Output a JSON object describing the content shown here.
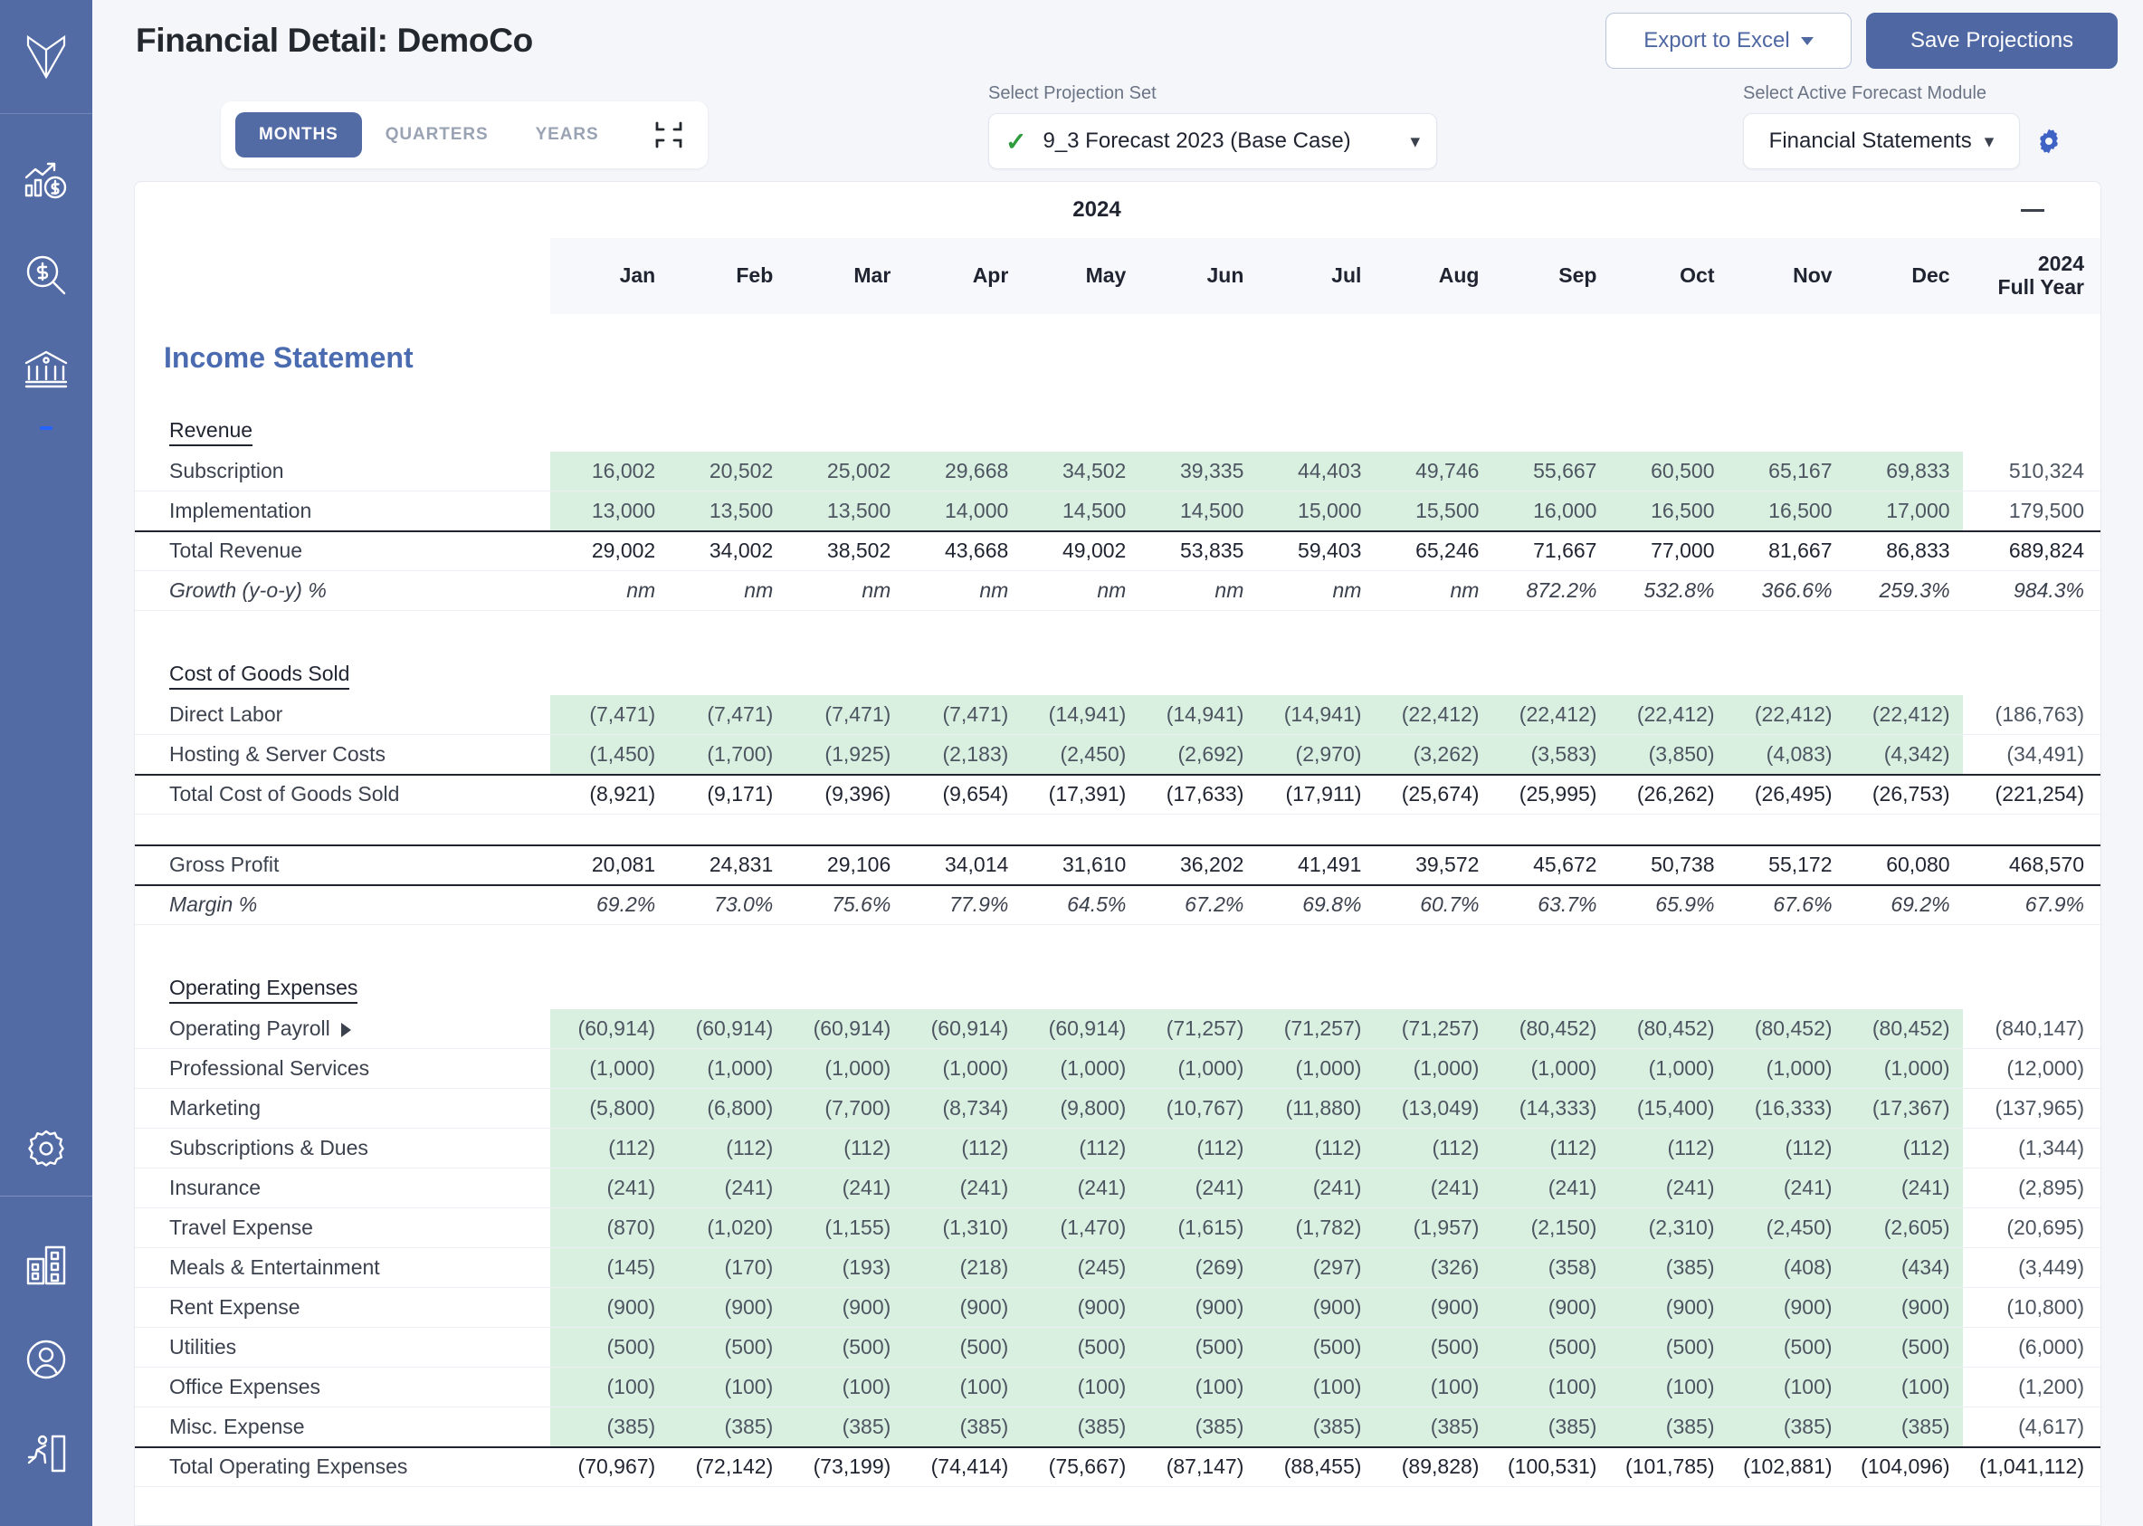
{
  "sidebar": {
    "logo_icon": "brand-chevron-logo",
    "items": [
      {
        "icon": "chart-growth-dollar-icon",
        "name": "analytics"
      },
      {
        "icon": "magnifier-dollar-icon",
        "name": "valuation"
      },
      {
        "icon": "bank-building-icon",
        "name": "banking"
      },
      {
        "icon": "gear-icon",
        "name": "settings"
      },
      {
        "icon": "company-buildings-icon",
        "name": "companies"
      },
      {
        "icon": "user-avatar-icon",
        "name": "account"
      },
      {
        "icon": "exit-door-icon",
        "name": "logout"
      }
    ]
  },
  "header": {
    "title": "Financial Detail: DemoCo",
    "export_label": "Export to Excel",
    "save_label": "Save Projections",
    "period_tabs": [
      {
        "label": "MONTHS",
        "active": true
      },
      {
        "label": "QUARTERS",
        "active": false
      },
      {
        "label": "YEARS",
        "active": false
      }
    ],
    "collapse_icon": "collapse-arrows-icon",
    "projection": {
      "label": "Select Projection Set",
      "value": "9_3 Forecast 2023 (Base Case)",
      "check_icon": "check-icon",
      "chevron_icon": "chevron-down-icon"
    },
    "module": {
      "label": "Select Active Forecast Module",
      "value": "Financial Statements",
      "chevron_icon": "chevron-down-icon",
      "gear_icon": "gear-icon"
    }
  },
  "table": {
    "year": "2024",
    "minimize_icon": "minimize-icon",
    "columns": [
      "Jan",
      "Feb",
      "Mar",
      "Apr",
      "May",
      "Jun",
      "Jul",
      "Aug",
      "Sep",
      "Oct",
      "Nov",
      "Dec"
    ],
    "fy_col_line1": "2024",
    "fy_col_line2": "Full Year",
    "statement_title": "Income Statement",
    "sections": [
      {
        "group": "Revenue",
        "rows": [
          {
            "label": "Subscription",
            "type": "input",
            "values": [
              "16,002",
              "20,502",
              "25,002",
              "29,668",
              "34,502",
              "39,335",
              "44,403",
              "49,746",
              "55,667",
              "60,500",
              "65,167",
              "69,833"
            ],
            "fy": "510,324"
          },
          {
            "label": "Implementation",
            "type": "input",
            "values": [
              "13,000",
              "13,500",
              "13,500",
              "14,000",
              "14,500",
              "14,500",
              "15,000",
              "15,500",
              "16,000",
              "16,500",
              "16,500",
              "17,000"
            ],
            "fy": "179,500"
          },
          {
            "label": "Total Revenue",
            "type": "total",
            "values": [
              "29,002",
              "34,002",
              "38,502",
              "43,668",
              "49,002",
              "53,835",
              "59,403",
              "65,246",
              "71,667",
              "77,000",
              "81,667",
              "86,833"
            ],
            "fy": "689,824"
          },
          {
            "label": "Growth (y-o-y) %",
            "type": "pct",
            "values": [
              "nm",
              "nm",
              "nm",
              "nm",
              "nm",
              "nm",
              "nm",
              "nm",
              "872.2%",
              "532.8%",
              "366.6%",
              "259.3%"
            ],
            "fy": "984.3%"
          }
        ]
      },
      {
        "group": "Cost of Goods Sold",
        "rows": [
          {
            "label": "Direct Labor",
            "type": "input",
            "values": [
              "(7,471)",
              "(7,471)",
              "(7,471)",
              "(7,471)",
              "(14,941)",
              "(14,941)",
              "(14,941)",
              "(22,412)",
              "(22,412)",
              "(22,412)",
              "(22,412)",
              "(22,412)"
            ],
            "fy": "(186,763)"
          },
          {
            "label": "Hosting & Server Costs",
            "type": "input",
            "values": [
              "(1,450)",
              "(1,700)",
              "(1,925)",
              "(2,183)",
              "(2,450)",
              "(2,692)",
              "(2,970)",
              "(3,262)",
              "(3,583)",
              "(3,850)",
              "(4,083)",
              "(4,342)"
            ],
            "fy": "(34,491)"
          },
          {
            "label": "Total Cost of Goods Sold",
            "type": "total",
            "values": [
              "(8,921)",
              "(9,171)",
              "(9,396)",
              "(9,654)",
              "(17,391)",
              "(17,633)",
              "(17,911)",
              "(25,674)",
              "(25,995)",
              "(26,262)",
              "(26,495)",
              "(26,753)"
            ],
            "fy": "(221,254)"
          }
        ]
      },
      {
        "group": "",
        "rows": [
          {
            "label": "Gross Profit",
            "type": "total-bb",
            "values": [
              "20,081",
              "24,831",
              "29,106",
              "34,014",
              "31,610",
              "36,202",
              "41,491",
              "39,572",
              "45,672",
              "50,738",
              "55,172",
              "60,080"
            ],
            "fy": "468,570"
          },
          {
            "label": "Margin %",
            "type": "pct",
            "values": [
              "69.2%",
              "73.0%",
              "75.6%",
              "77.9%",
              "64.5%",
              "67.2%",
              "69.8%",
              "60.7%",
              "63.7%",
              "65.9%",
              "67.6%",
              "69.2%"
            ],
            "fy": "67.9%"
          }
        ]
      },
      {
        "group": "Operating Expenses",
        "rows": [
          {
            "label": "Operating Payroll",
            "type": "input",
            "expandable": true,
            "values": [
              "(60,914)",
              "(60,914)",
              "(60,914)",
              "(60,914)",
              "(60,914)",
              "(71,257)",
              "(71,257)",
              "(71,257)",
              "(80,452)",
              "(80,452)",
              "(80,452)",
              "(80,452)"
            ],
            "fy": "(840,147)"
          },
          {
            "label": "Professional Services",
            "type": "input",
            "values": [
              "(1,000)",
              "(1,000)",
              "(1,000)",
              "(1,000)",
              "(1,000)",
              "(1,000)",
              "(1,000)",
              "(1,000)",
              "(1,000)",
              "(1,000)",
              "(1,000)",
              "(1,000)"
            ],
            "fy": "(12,000)"
          },
          {
            "label": "Marketing",
            "type": "input",
            "values": [
              "(5,800)",
              "(6,800)",
              "(7,700)",
              "(8,734)",
              "(9,800)",
              "(10,767)",
              "(11,880)",
              "(13,049)",
              "(14,333)",
              "(15,400)",
              "(16,333)",
              "(17,367)"
            ],
            "fy": "(137,965)"
          },
          {
            "label": "Subscriptions & Dues",
            "type": "input",
            "values": [
              "(112)",
              "(112)",
              "(112)",
              "(112)",
              "(112)",
              "(112)",
              "(112)",
              "(112)",
              "(112)",
              "(112)",
              "(112)",
              "(112)"
            ],
            "fy": "(1,344)"
          },
          {
            "label": "Insurance",
            "type": "input",
            "values": [
              "(241)",
              "(241)",
              "(241)",
              "(241)",
              "(241)",
              "(241)",
              "(241)",
              "(241)",
              "(241)",
              "(241)",
              "(241)",
              "(241)"
            ],
            "fy": "(2,895)"
          },
          {
            "label": "Travel Expense",
            "type": "input",
            "values": [
              "(870)",
              "(1,020)",
              "(1,155)",
              "(1,310)",
              "(1,470)",
              "(1,615)",
              "(1,782)",
              "(1,957)",
              "(2,150)",
              "(2,310)",
              "(2,450)",
              "(2,605)"
            ],
            "fy": "(20,695)"
          },
          {
            "label": "Meals & Entertainment",
            "type": "input",
            "values": [
              "(145)",
              "(170)",
              "(193)",
              "(218)",
              "(245)",
              "(269)",
              "(297)",
              "(326)",
              "(358)",
              "(385)",
              "(408)",
              "(434)"
            ],
            "fy": "(3,449)"
          },
          {
            "label": "Rent Expense",
            "type": "input",
            "values": [
              "(900)",
              "(900)",
              "(900)",
              "(900)",
              "(900)",
              "(900)",
              "(900)",
              "(900)",
              "(900)",
              "(900)",
              "(900)",
              "(900)"
            ],
            "fy": "(10,800)"
          },
          {
            "label": "Utilities",
            "type": "input",
            "values": [
              "(500)",
              "(500)",
              "(500)",
              "(500)",
              "(500)",
              "(500)",
              "(500)",
              "(500)",
              "(500)",
              "(500)",
              "(500)",
              "(500)"
            ],
            "fy": "(6,000)"
          },
          {
            "label": "Office Expenses",
            "type": "input",
            "values": [
              "(100)",
              "(100)",
              "(100)",
              "(100)",
              "(100)",
              "(100)",
              "(100)",
              "(100)",
              "(100)",
              "(100)",
              "(100)",
              "(100)"
            ],
            "fy": "(1,200)"
          },
          {
            "label": "Misc. Expense",
            "type": "input",
            "values": [
              "(385)",
              "(385)",
              "(385)",
              "(385)",
              "(385)",
              "(385)",
              "(385)",
              "(385)",
              "(385)",
              "(385)",
              "(385)",
              "(385)"
            ],
            "fy": "(4,617)"
          },
          {
            "label": "Total Operating Expenses",
            "type": "total",
            "values": [
              "(70,967)",
              "(72,142)",
              "(73,199)",
              "(74,414)",
              "(75,667)",
              "(87,147)",
              "(88,455)",
              "(89,828)",
              "(100,531)",
              "(101,785)",
              "(102,881)",
              "(104,096)"
            ],
            "fy": "(1,041,112)"
          }
        ]
      }
    ]
  }
}
